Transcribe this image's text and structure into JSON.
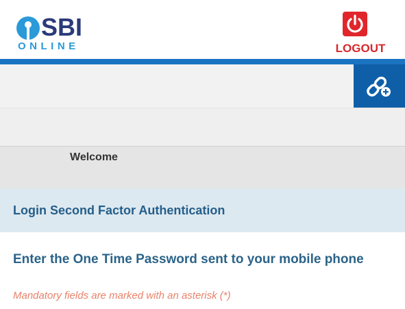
{
  "header": {
    "logo_text": "SBI",
    "logo_subtext": "ONLINE",
    "logout_label": "LOGOUT"
  },
  "toolbar": {
    "quick_link_icon": "link-plus-icon"
  },
  "welcome": {
    "text": "Welcome"
  },
  "auth": {
    "title": "Login Second Factor Authentication"
  },
  "main": {
    "otp_heading": "Enter the One Time Password sent to your mobile phone",
    "mandatory_note": "Mandatory fields are marked with an asterisk (*)"
  },
  "colors": {
    "brand_blue": "#1a74c2",
    "logout_red": "#e0262b",
    "heading_blue": "#2b6389",
    "note_orange": "#e8826a"
  }
}
